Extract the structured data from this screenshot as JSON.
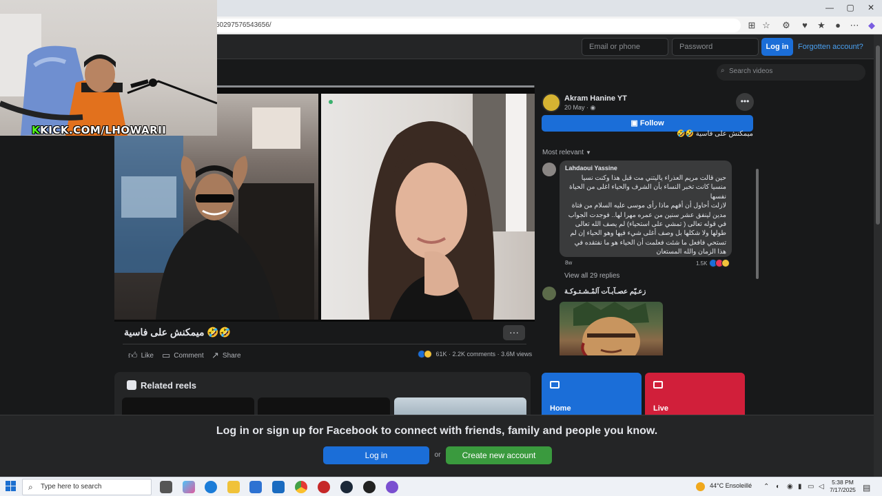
{
  "browser": {
    "url": "60297576543656/",
    "window_controls": [
      "—",
      "▢",
      "✕"
    ]
  },
  "header": {
    "email_placeholder": "Email or phone",
    "password_placeholder": "Password",
    "login_label": "Log in",
    "forgot_label": "Forgotten account?",
    "search_placeholder": "Search videos"
  },
  "stream_overlay": {
    "kick_prefix": "K",
    "kick_text": "KICK.COM/LHOWARII"
  },
  "video": {
    "progress": 0.998,
    "title": "ميمكنش على فاسية 🤣🤣",
    "more_label": "···",
    "actions": {
      "like": "Like",
      "comment": "Comment",
      "share": "Share"
    },
    "stats": {
      "reactions": "61K",
      "comments": "2.2K comments",
      "views": "3.6M views"
    }
  },
  "related": {
    "title": "Related reels"
  },
  "post": {
    "page_name": "Akram Hanine YT",
    "date": "20 May",
    "date_suffix": "·",
    "follow_label": "Follow",
    "caption": "ميمكنش على فاسية 🤣🤣",
    "sort_label": "Most relevant"
  },
  "comments": [
    {
      "author": "Lahdaoui Yassine",
      "text": "حين قالت مريم العذراء ياليتني مت قبل هذا وكنت نسيا منسيا كانت تخبر النساء بأن الشرف والحياء اغلى من الحياة نفسها\nلازلت أحاول أن أفهم ماذا رأى موسى عليه السلام من فتاة مدين لينفق عشر سنين من عمره مهرا لها.. فوجدت الجواب في قوله تعالى ( تمشي على استحياء) لم يصف الله تعالى طولها ولا شكلها بل وصف أغلى شيء فيها وهو الحياء إن لم تستحي فافعل ما شئت فعلمت أن الحياء هو ما نفتقده في هذا الزمان والله المستعان",
      "time": "8w",
      "reactions": "1.5K",
      "replies": "View all 29 replies"
    },
    {
      "author": "زعـيّم عصـآبـآت آلمْـشـتـوكـة"
    }
  ],
  "cards": {
    "home": "Home",
    "live": "Live"
  },
  "banner": {
    "text": "Log in or sign up for Facebook to connect with friends, family and people you know.",
    "login": "Log in",
    "or": "or",
    "create": "Create new account"
  },
  "taskbar": {
    "search_placeholder": "Type here to search",
    "weather": "44°C  Ensoleillé",
    "time": "5:38 PM",
    "date": "7/17/2025"
  },
  "colors": {
    "fb_blue": "#1b6ed8",
    "create_green": "#3a9a3e",
    "live_red": "#d11f3a",
    "kick_green": "#53fc18"
  }
}
